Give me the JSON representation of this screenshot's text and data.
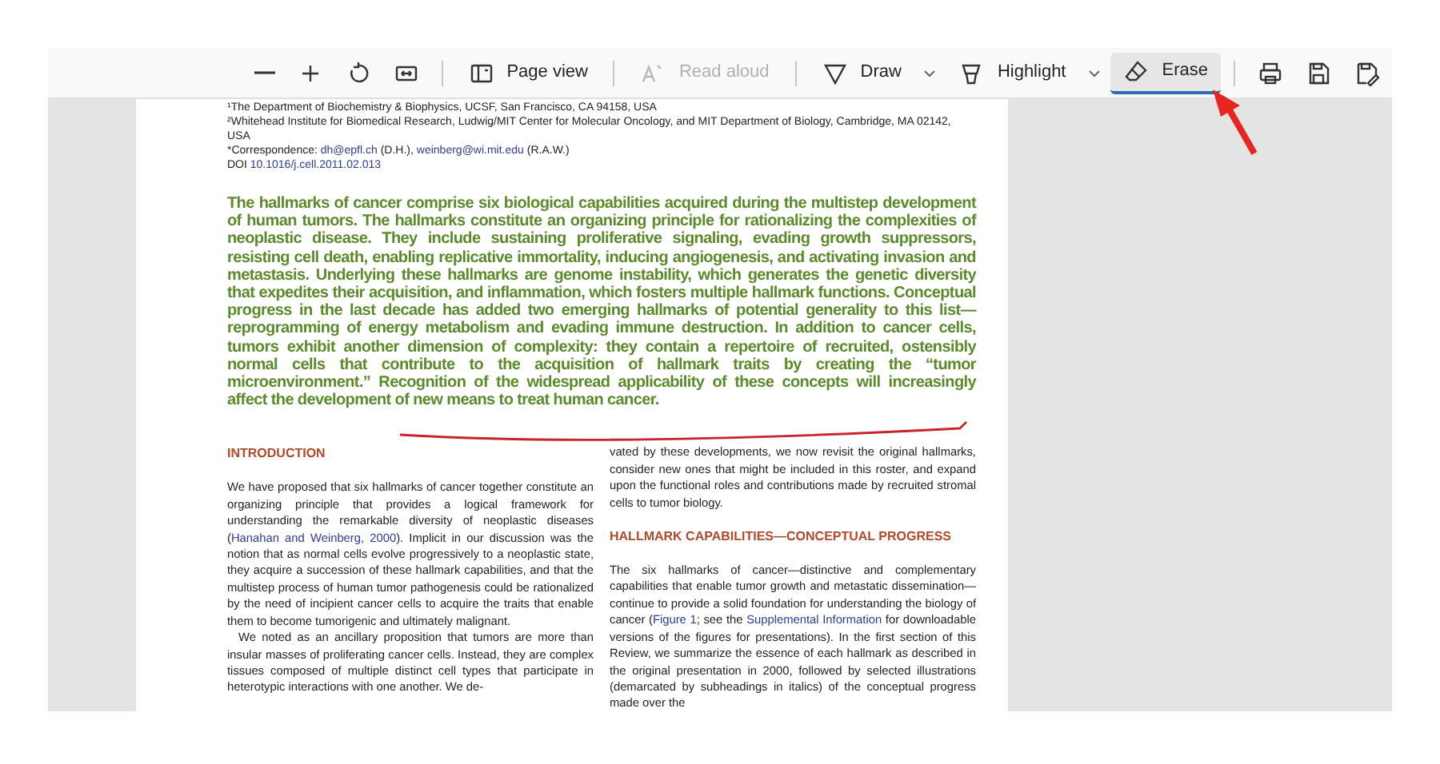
{
  "toolbar": {
    "items": [
      {
        "kind": "zoom-out"
      },
      {
        "kind": "zoom-in"
      },
      {
        "kind": "rotate"
      },
      {
        "kind": "fit"
      },
      {
        "kind": "divider"
      },
      {
        "kind": "page-view",
        "label": "Page view"
      },
      {
        "kind": "divider"
      },
      {
        "kind": "read-aloud",
        "label": "Read aloud",
        "disabled": true
      },
      {
        "kind": "divider"
      },
      {
        "kind": "draw",
        "label": "Draw",
        "menu": true
      },
      {
        "kind": "highlight",
        "label": "Highlight",
        "menu": true
      },
      {
        "kind": "erase",
        "label": "Erase",
        "selected": true
      },
      {
        "kind": "divider"
      },
      {
        "kind": "print"
      },
      {
        "kind": "save"
      },
      {
        "kind": "save-as"
      }
    ]
  },
  "document": {
    "affiliations": [
      [
        {
          "text": "¹The Department of Biochemistry & Biophysics, UCSF, San Francisco, CA 94158, USA"
        }
      ],
      [
        {
          "text": "²Whitehead Institute for Biomedical Research, Ludwig/MIT Center for Molecular Oncology, and MIT Department of Biology, Cambridge, MA 02142, USA"
        }
      ],
      [
        {
          "text": "*Correspondence: "
        },
        {
          "text": "dh@epfl.ch",
          "link": true
        },
        {
          "text": " (D.H.), "
        },
        {
          "text": "weinberg@wi.mit.edu",
          "link": true
        },
        {
          "text": " (R.A.W.)"
        }
      ],
      [
        {
          "text": "DOI "
        },
        {
          "text": "10.1016/j.cell.2011.02.013",
          "link": true
        }
      ]
    ],
    "abstract": "The hallmarks of cancer comprise six biological capabilities acquired during the multistep development of human tumors. The hallmarks constitute an organizing principle for rationalizing the complexities of neoplastic disease. They include sustaining proliferative signaling, evading growth suppressors, resisting cell death, enabling replicative immortality, inducing angiogenesis, and activating invasion and metastasis. Underlying these hallmarks are genome instability, which generates the genetic diversity that expedites their acquisition, and inflammation, which fosters multiple hallmark functions. Conceptual progress in the last decade has added two emerging hallmarks of potential generality to this list—reprogramming of energy metabolism and evading immune destruction. In addition to cancer cells, tumors exhibit another dimension of complexity: they contain a repertoire of recruited, ostensibly normal cells that contribute to the acquisition of hallmark traits by creating the “tumor microenvironment.” Recognition of the widespread applicability of these concepts will increasingly affect the development of new means to treat human cancer.",
    "columns": [
      [
        {
          "kind": "heading",
          "parts": [
            {
              "text": "INTRODUCTION"
            }
          ]
        },
        {
          "kind": "paragraph",
          "parts": [
            {
              "text": "We have proposed that six hallmarks of cancer together constitute an organizing principle that provides a logical framework for understanding the remarkable diversity of neoplastic diseases ("
            },
            {
              "text": "Hanahan and Weinberg, 2000",
              "link": true
            },
            {
              "text": "). Implicit in our discussion was the notion that as normal cells evolve progressively to a neoplastic state, they acquire a succession of these hallmark capabilities, and that the multistep process of human tumor pathogenesis could be rationalized by the need of incipient cancer cells to acquire the traits that enable them to become tumorigenic and ultimately malignant."
            }
          ]
        },
        {
          "kind": "paragraph",
          "indent": true,
          "parts": [
            {
              "text": "We noted as an ancillary proposition that tumors are more than insular masses of proliferating cancer cells. Instead, they are complex tissues composed of multiple distinct cell types that participate in heterotypic interactions with one another. We de-"
            }
          ]
        }
      ],
      [
        {
          "kind": "paragraph",
          "parts": [
            {
              "text": "vated by these developments, we now revisit the original hallmarks, consider new ones that might be included in this roster, and expand upon the functional roles and contributions made by recruited stromal cells to tumor biology."
            }
          ]
        },
        {
          "kind": "heading",
          "parts": [
            {
              "text": "HALLMARK CAPABILITIES—CONCEPTUAL PROGRESS"
            }
          ]
        },
        {
          "kind": "paragraph",
          "parts": [
            {
              "text": "The six hallmarks of cancer—distinctive and complementary capabilities that enable tumor growth and metastatic dissemination—continue to provide a solid foundation for understanding the biology of cancer ("
            },
            {
              "text": "Figure 1",
              "link": true
            },
            {
              "text": "; see the "
            },
            {
              "text": "Supplemental Information",
              "link": true
            },
            {
              "text": " for downloadable versions of the figures for presentations). In the first section of this Review, we summarize the essence of each hallmark as described in the original presentation in 2000, followed by selected illustrations (demarcated by subheadings in italics) of the conceptual progress made over the"
            }
          ]
        }
      ]
    ]
  }
}
